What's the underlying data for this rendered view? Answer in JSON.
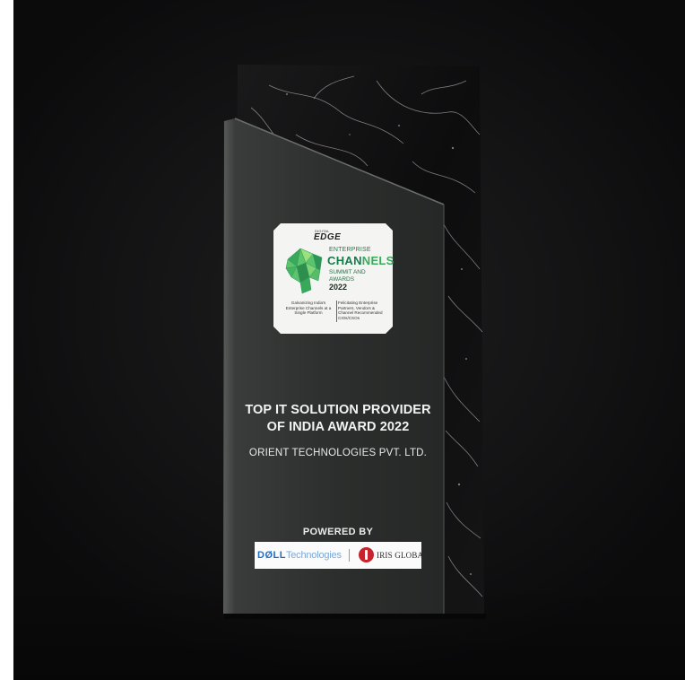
{
  "event_logo": {
    "brand_small": "DIGITAL",
    "brand_name": "EDGE",
    "line1": "ENTERPRISE",
    "headline_a": "CHAN",
    "headline_b": "NELS",
    "line3a": "SUMMIT AND",
    "line3b": "AWARDS",
    "year": "2022",
    "tagline_left": "Galvanizing India's Enterprise Channels at a Single Platform",
    "tagline_right": "Felicitating Enterprise Partners, Vendors & Channel Recommended CIOs/CSOs"
  },
  "award": {
    "title_line1": "TOP IT SOLUTION PROVIDER",
    "title_line2": "OF INDIA AWARD 2022",
    "recipient": "ORIENT TECHNOLOGIES PVT. LTD."
  },
  "sponsors": {
    "powered_by_label": "POWERED BY",
    "dell_bold": "DØLL",
    "dell_light": "Technologies",
    "iris": "IRIS GLOBAL"
  },
  "colors": {
    "background": "#141415",
    "panel": "#2b2d2c",
    "marble": "#0f0f10",
    "accent_green": "#177b4b",
    "dell_blue": "#1f6fc4",
    "iris_red": "#c8232c"
  }
}
